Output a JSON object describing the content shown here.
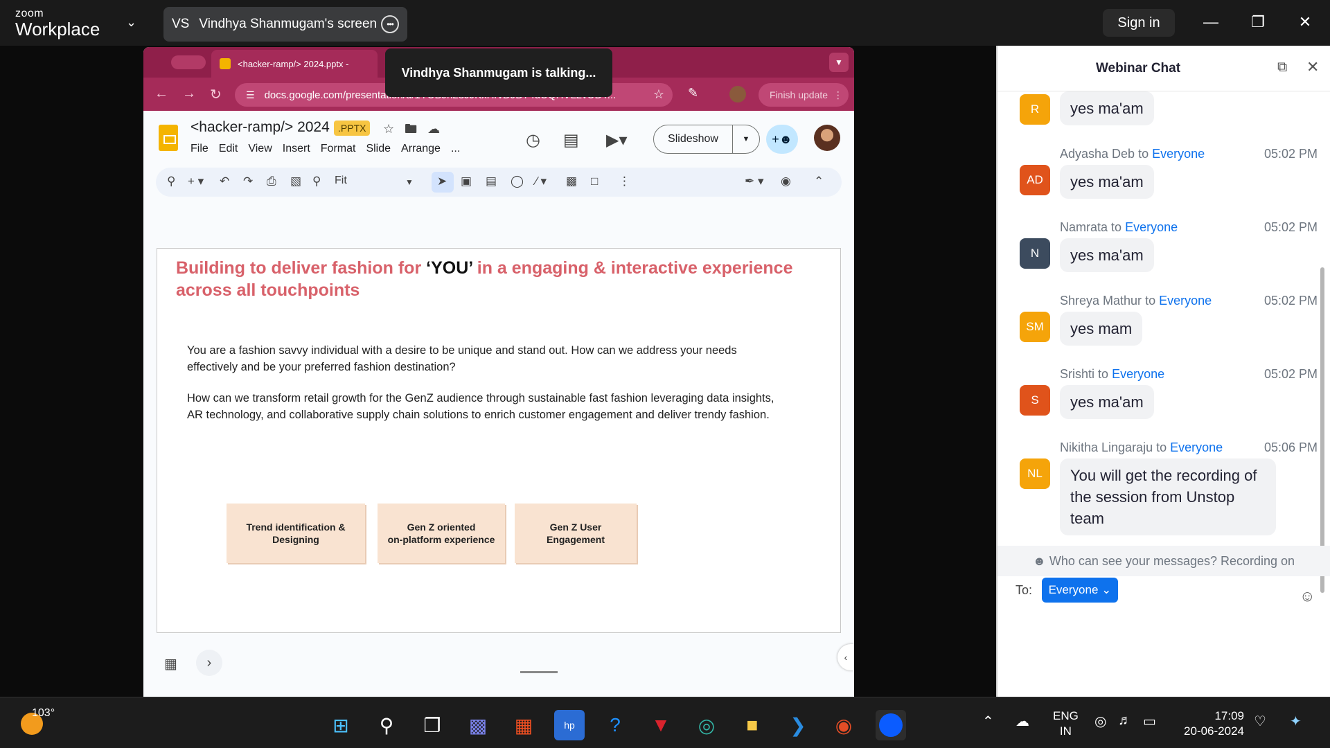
{
  "zoom": {
    "logo_small": "zoom",
    "logo_big": "Workplace",
    "share_initials": "VS",
    "share_title": "Vindhya Shanmugam's screen",
    "more_glyph": "•••",
    "sign_in": "Sign in",
    "talking_banner": "Vindhya Shanmugam is talking..."
  },
  "browser": {
    "tab_title": "<hacker-ramp/> 2024.pptx -",
    "url": "docs.google.com/presentation/d/1YUBJh23JJKxHrvDJD74uUQHVL2vUDT...",
    "finish_update": "Finish update"
  },
  "slides_app": {
    "doc_title": "<hacker-ramp/> 2024",
    "badge": ".PPTX",
    "menus": [
      "File",
      "Edit",
      "View",
      "Insert",
      "Format",
      "Slide",
      "Arrange",
      "..."
    ],
    "slideshow_label": "Slideshow",
    "zoom_label": "Fit"
  },
  "slide": {
    "title_a": "Building to deliver fashion for ",
    "title_you": "‘YOU’",
    "title_b": " in a engaging & interactive experience across all touchpoints",
    "para1": "You are a fashion savvy individual with a desire to be unique and stand out. How can we address your needs effectively and be your preferred fashion destination?",
    "para2": "How can we transform retail growth for the GenZ audience through sustainable fast fashion leveraging data insights, AR technology, and collaborative supply chain solutions to enrich customer engagement and deliver trendy fashion.",
    "cards": [
      "Trend identification &\nDesigning",
      "Gen Z oriented\non-platform experience",
      "Gen Z User\nEngagement"
    ]
  },
  "chat": {
    "title": "Webinar Chat",
    "messages": [
      {
        "initials": "R",
        "color": "#f5a40a",
        "sender": "",
        "to": "",
        "time": "",
        "text": "yes ma'am"
      },
      {
        "initials": "AD",
        "color": "#e0531b",
        "sender": "Adyasha Deb",
        "to": "Everyone",
        "time": "05:02 PM",
        "text": "yes ma'am"
      },
      {
        "initials": "N",
        "color": "#3c4b5e",
        "sender": "Namrata",
        "to": "Everyone",
        "time": "05:02 PM",
        "text": "yes ma'am"
      },
      {
        "initials": "SM",
        "color": "#f5a40a",
        "sender": "Shreya Mathur",
        "to": "Everyone",
        "time": "05:02 PM",
        "text": "yes mam"
      },
      {
        "initials": "S",
        "color": "#e0531b",
        "sender": "Srishti",
        "to": "Everyone",
        "time": "05:02 PM",
        "text": "yes ma'am"
      },
      {
        "initials": "NL",
        "color": "#f5a40a",
        "sender": "Nikitha Lingaraju",
        "to": "Everyone",
        "time": "05:06 PM",
        "text": "You will get the recording of the session from Unstop team"
      }
    ],
    "to_word": "to",
    "notice": "Who can see your messages? Recording on",
    "to_label": "To:",
    "to_value": "Everyone"
  },
  "taskbar": {
    "temperature": "103°",
    "lang_top": "ENG",
    "lang_bottom": "IN",
    "time": "17:09",
    "date": "20-06-2024"
  }
}
